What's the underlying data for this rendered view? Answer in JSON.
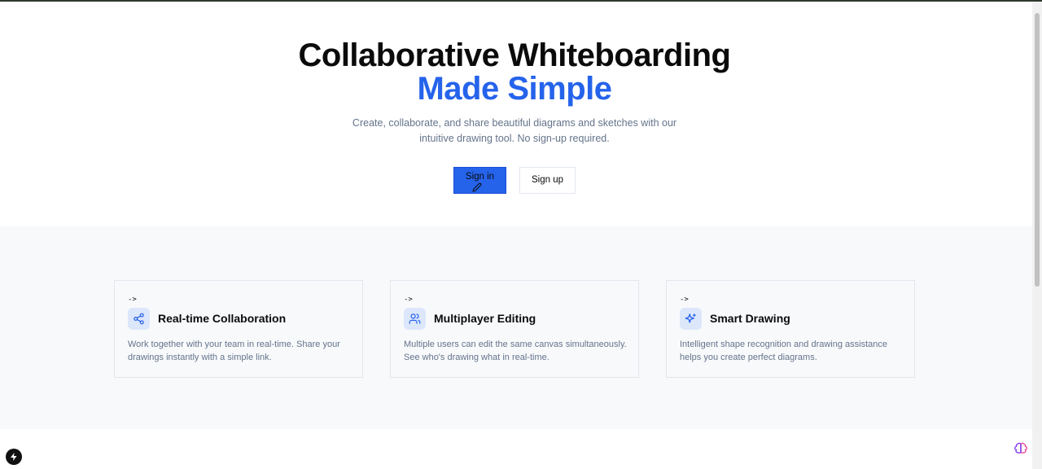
{
  "hero": {
    "title_line1": "Collaborative Whiteboarding",
    "title_line2": "Made Simple",
    "subtitle": "Create, collaborate, and share beautiful diagrams and sketches with our intuitive drawing tool. No sign-up required.",
    "signin_label": "Sign in",
    "signup_label": "Sign up"
  },
  "features": [
    {
      "marker": "->",
      "icon": "share-icon",
      "title": "Real-time Collaboration",
      "description": "Work together with your team in real-time. Share your drawings instantly with a simple link."
    },
    {
      "marker": "->",
      "icon": "users-icon",
      "title": "Multiplayer Editing",
      "description": "Multiple users can edit the same canvas simultaneously. See who's drawing what in real-time."
    },
    {
      "marker": "->",
      "icon": "sparkles-icon",
      "title": "Smart Drawing",
      "description": "Intelligent shape recognition and drawing assistance helps you create perfect diagrams."
    }
  ],
  "colors": {
    "accent": "#2563eb",
    "muted_text": "#64748b",
    "section_bg": "#f8f9fb"
  }
}
